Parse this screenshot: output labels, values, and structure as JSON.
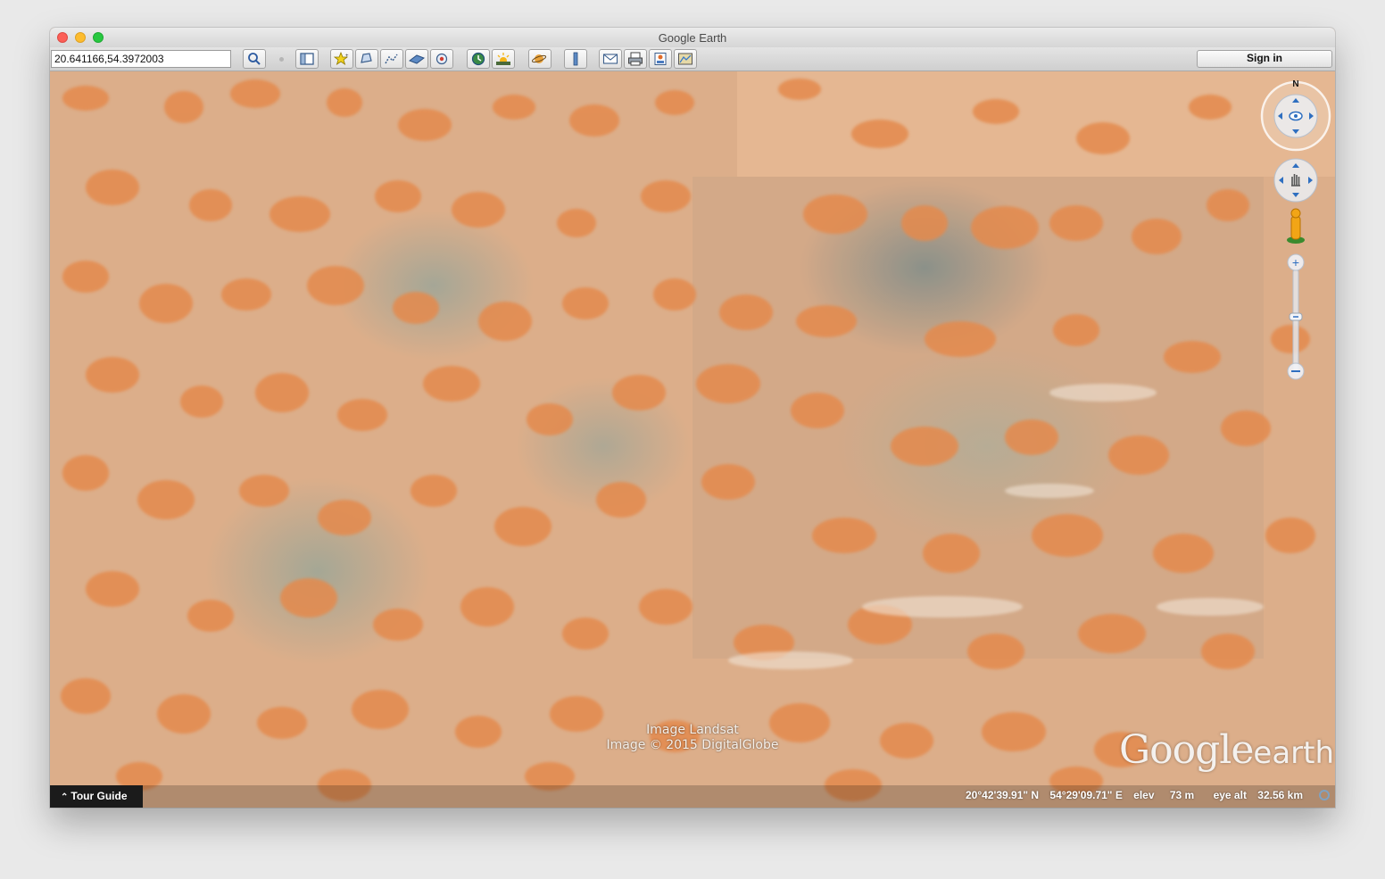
{
  "window": {
    "title": "Google Earth"
  },
  "toolbar": {
    "search_value": "20.641166,54.3972003",
    "buttons": [
      "search-icon",
      "sidebar-icon",
      "placemark-icon",
      "polygon-icon",
      "path-icon",
      "image-overlay-icon",
      "record-tour-icon",
      "historical-imagery-icon",
      "sunlight-icon",
      "planets-icon",
      "ruler-icon",
      "email-icon",
      "print-icon",
      "save-image-icon",
      "view-in-maps-icon"
    ],
    "signin_label": "Sign in"
  },
  "map": {
    "credit_line1": "Image Landsat",
    "credit_line2": "Image © 2015 DigitalGlobe",
    "logo_google": "Google",
    "logo_earth": "earth",
    "compass_label": "N"
  },
  "statusbar": {
    "tour_guide_label": "Tour Guide",
    "lat": "20°42'39.91\" N",
    "lon": "54°29'09.71\" E",
    "elev_label": "elev",
    "elev_value": "73 m",
    "eye_alt_label": "eye alt",
    "eye_alt_value": "32.56 km"
  },
  "colors": {
    "sand": "#dcae8a",
    "dune": "#e48a4e",
    "water": "#7fa0a0"
  }
}
